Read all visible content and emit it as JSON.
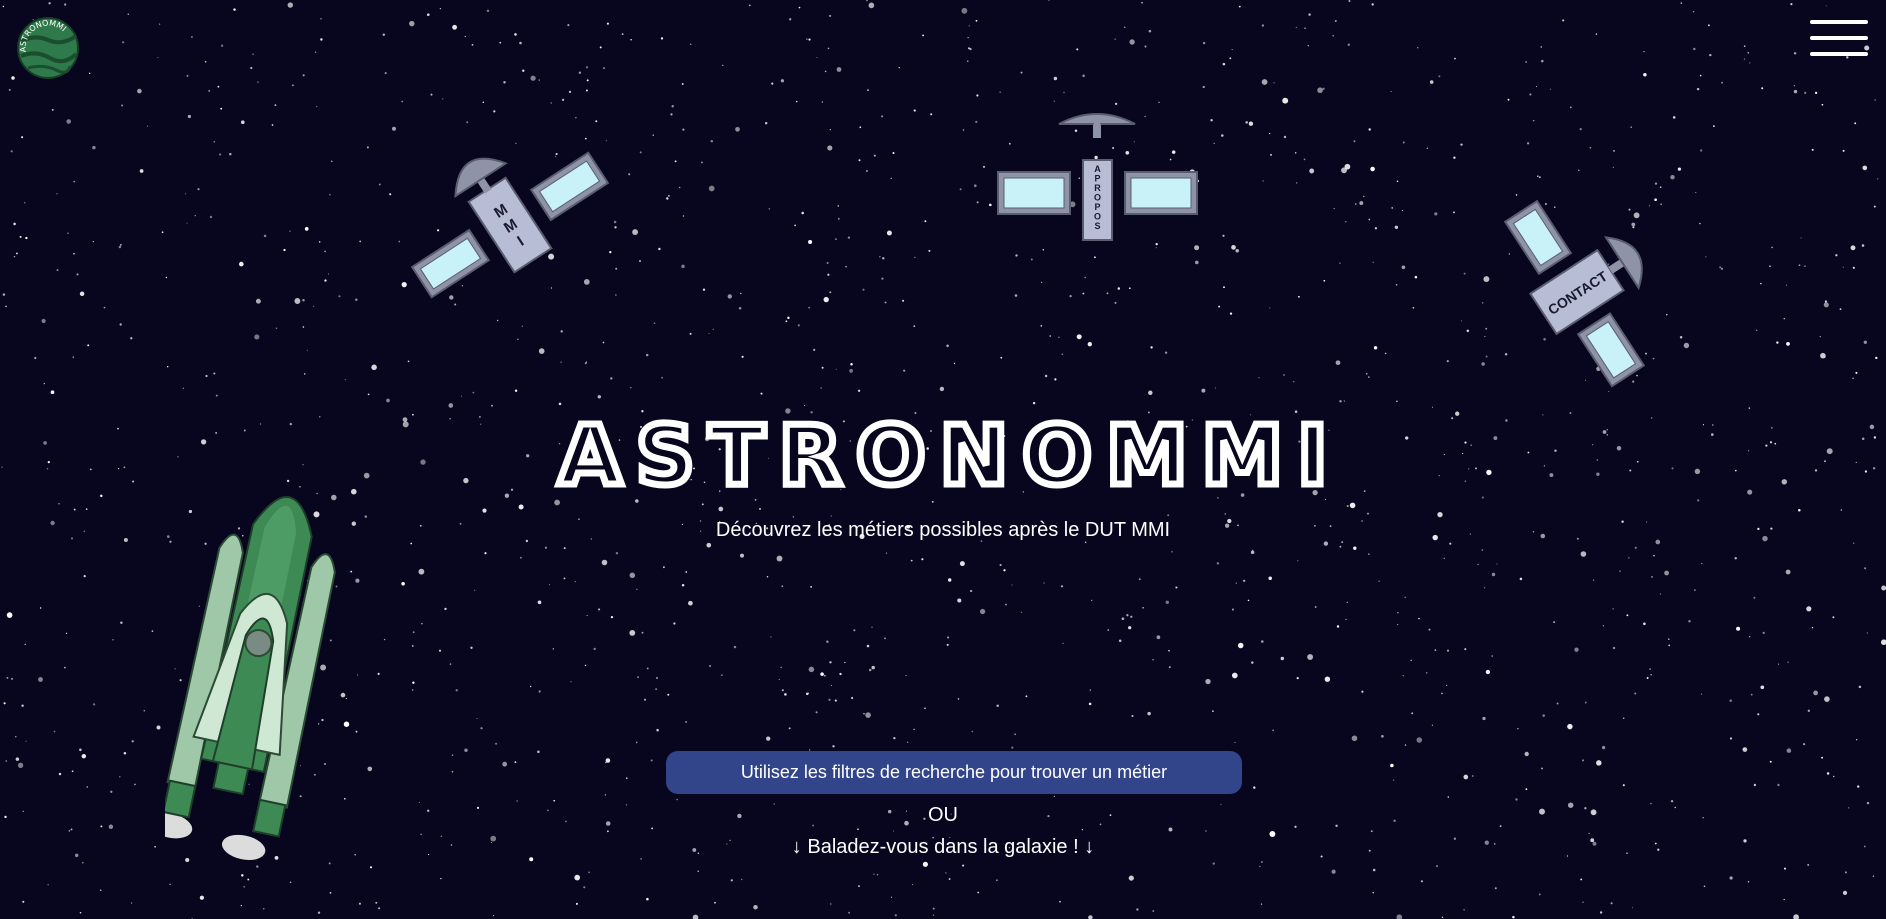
{
  "header": {
    "logo_text": "ASTRONOMMI",
    "menu_icon": "hamburger-menu-icon"
  },
  "satellites": [
    {
      "label": "MMI",
      "icon": "satellite-icon"
    },
    {
      "label": "A PROPOS",
      "icon": "satellite-icon"
    },
    {
      "label": "CONTACT",
      "icon": "satellite-icon"
    }
  ],
  "hero": {
    "title": "ASTRONOMMI",
    "subtitle": "Découvrez les métiers possibles après le DUT MMI"
  },
  "actions": {
    "search_button_label": "Utilisez les filtres de recherche pour trouver un métier",
    "separator": "OU",
    "explore_label": "↓ Baladez-vous dans la galaxie ! ↓"
  },
  "decor": {
    "rocket_icon": "rocket-icon"
  },
  "colors": {
    "background": "#08051f",
    "button": "#33458a",
    "satellite_body": "#b8bdd6",
    "satellite_panel": "#c9f2f8",
    "rocket_green": "#3d8a55",
    "logo_green": "#2e7a4a"
  }
}
